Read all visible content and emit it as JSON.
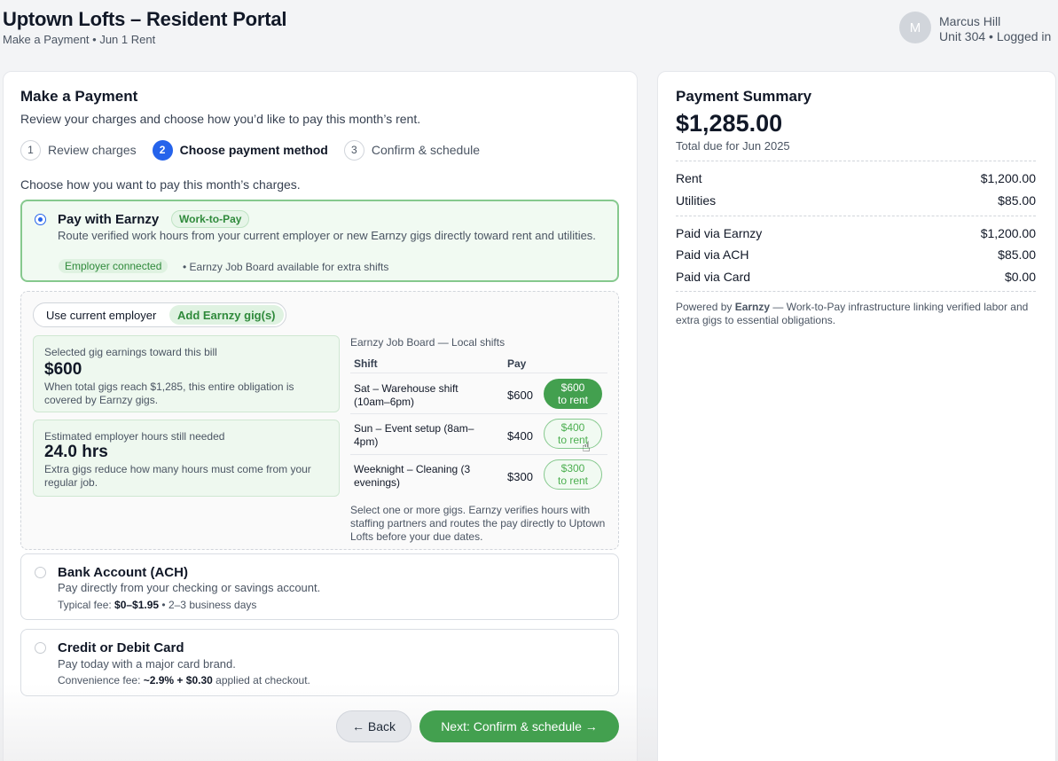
{
  "header": {
    "title": "Uptown Lofts – Resident Portal",
    "subtitle": "Make a Payment • Jun 1 Rent",
    "avatar_initial": "M",
    "user_name": "Marcus Hill",
    "user_meta": "Unit 304 • Logged in"
  },
  "payment": {
    "title": "Make a Payment",
    "description": "Review your charges and choose how you’d like to pay this month’s rent.",
    "steps": [
      {
        "num": "1",
        "label": "Review charges"
      },
      {
        "num": "2",
        "label": "Choose payment method"
      },
      {
        "num": "3",
        "label": "Confirm & schedule"
      }
    ],
    "choose_label": "Choose how you want to pay this month’s charges."
  },
  "earnzy": {
    "title": "Pay with Earnzy",
    "tag": "Work-to-Pay",
    "description": "Route verified work hours from your current employer or new Earnzy gigs directly toward rent and utilities.",
    "status_chip": "Employer connected",
    "status_note": "• Earnzy Job Board available for extra shifts",
    "toggle_current": "Use current employer",
    "toggle_add": "Add Earnzy gig(s)",
    "gig_earnings_label": "Selected gig earnings toward this bill",
    "gig_earnings_value": "$600",
    "gig_earnings_note": "When total gigs reach $1,285, this entire obligation is covered by Earnzy gigs.",
    "hours_label": "Estimated employer hours still needed",
    "hours_value": "24.0 hrs",
    "hours_note": "Extra gigs reduce how many hours must come from your regular job.",
    "job_board_title": "Earnzy Job Board — Local shifts",
    "col_shift": "Shift",
    "col_pay": "Pay",
    "jobs": [
      {
        "shift": "Sat – Warehouse shift (10am–6pm)",
        "pay": "$600",
        "btn_amount": "$600",
        "btn_text": "to rent"
      },
      {
        "shift": "Sun – Event setup (8am–4pm)",
        "pay": "$400",
        "btn_amount": "$400",
        "btn_text": "to rent"
      },
      {
        "shift": "Weeknight – Cleaning (3 evenings)",
        "pay": "$300",
        "btn_amount": "$300",
        "btn_text": "to rent"
      }
    ],
    "job_note": "Select one or more gigs. Earnzy verifies hours with staffing partners and routes the pay directly to Uptown Lofts before your due dates."
  },
  "ach": {
    "title": "Bank Account (ACH)",
    "description": "Pay directly from your checking or savings account.",
    "fee_prefix": "Typical fee: ",
    "fee_value": "$0–$1.95",
    "fee_suffix": " • 2–3 business days"
  },
  "card": {
    "title": "Credit or Debit Card",
    "description": "Pay today with a major card brand.",
    "fee_prefix": "Convenience fee: ",
    "fee_value": "~2.9% + $0.30",
    "fee_suffix": " applied at checkout."
  },
  "buttons": {
    "back": "← Back",
    "next": "Next: Confirm & schedule →"
  },
  "summary": {
    "title": "Payment Summary",
    "total": "$1,285.00",
    "total_label": "Total due for Jun 2025",
    "charges": [
      {
        "label": "Rent",
        "value": "$1,200.00"
      },
      {
        "label": "Utilities",
        "value": "$85.00"
      }
    ],
    "payments": [
      {
        "label": "Paid via Earnzy",
        "value": "$1,200.00"
      },
      {
        "label": "Paid via ACH",
        "value": "$85.00"
      },
      {
        "label": "Paid via Card",
        "value": "$0.00"
      }
    ],
    "footer_prefix": "Powered by ",
    "footer_brand": "Earnzy",
    "footer_text": " — Work-to-Pay infrastructure linking verified labor and extra gigs to essential obligations."
  },
  "colors": {
    "accent_blue": "#2563eb",
    "accent_green": "#43a04f",
    "selected_bg": "#f1faf2"
  }
}
